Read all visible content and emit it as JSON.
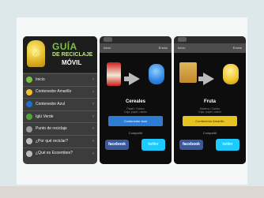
{
  "brand": {
    "line1": "GUÍA",
    "line2": "DE RECICLAJE",
    "line3": "MÓVIL"
  },
  "menu": [
    {
      "label": "Inicio",
      "icon": "house-icon",
      "color": "#7bc043"
    },
    {
      "label": "Contenedor Amarillo",
      "icon": "bin-yellow-icon",
      "color": "#f2c02c"
    },
    {
      "label": "Contenedor Azul",
      "icon": "bin-blue-icon",
      "color": "#1f6fd1"
    },
    {
      "label": "Iglú Verde",
      "icon": "igloo-green-icon",
      "color": "#52a53a"
    },
    {
      "label": "Punto de reciclaje",
      "icon": "recycle-icon",
      "color": "#9c9c9c"
    },
    {
      "label": "¿Por qué reciclar?",
      "icon": "question-icon",
      "color": "#bdbdbd"
    },
    {
      "label": "¿Qué es Ecoembes?",
      "icon": "info-icon",
      "color": "#bdbdbd"
    }
  ],
  "detail_screens": [
    {
      "back": "Atrás",
      "topbar_left": "Inicio",
      "topbar_right": "Enviar",
      "title": "Cereales",
      "desc": "Papel / Cartón",
      "desc2": "Caja, papel, cartón",
      "button_label": "Contenedor Azul",
      "button_color": "#2d7cd6",
      "share": "Compartir",
      "facebook": "facebook",
      "twitter": "twitter",
      "target_color": "#2f86e1"
    },
    {
      "back": "Atrás",
      "topbar_left": "Inicio",
      "topbar_right": "Enviar",
      "title": "Fruta",
      "desc": "Madera / Cartón",
      "desc2": "Caja, papel, cartón",
      "button_label": "Contenedor Amarillo",
      "button_color": "#e6c31f",
      "share": "Compartir",
      "facebook": "facebook",
      "twitter": "twitter",
      "target_color": "#f0c529"
    }
  ]
}
